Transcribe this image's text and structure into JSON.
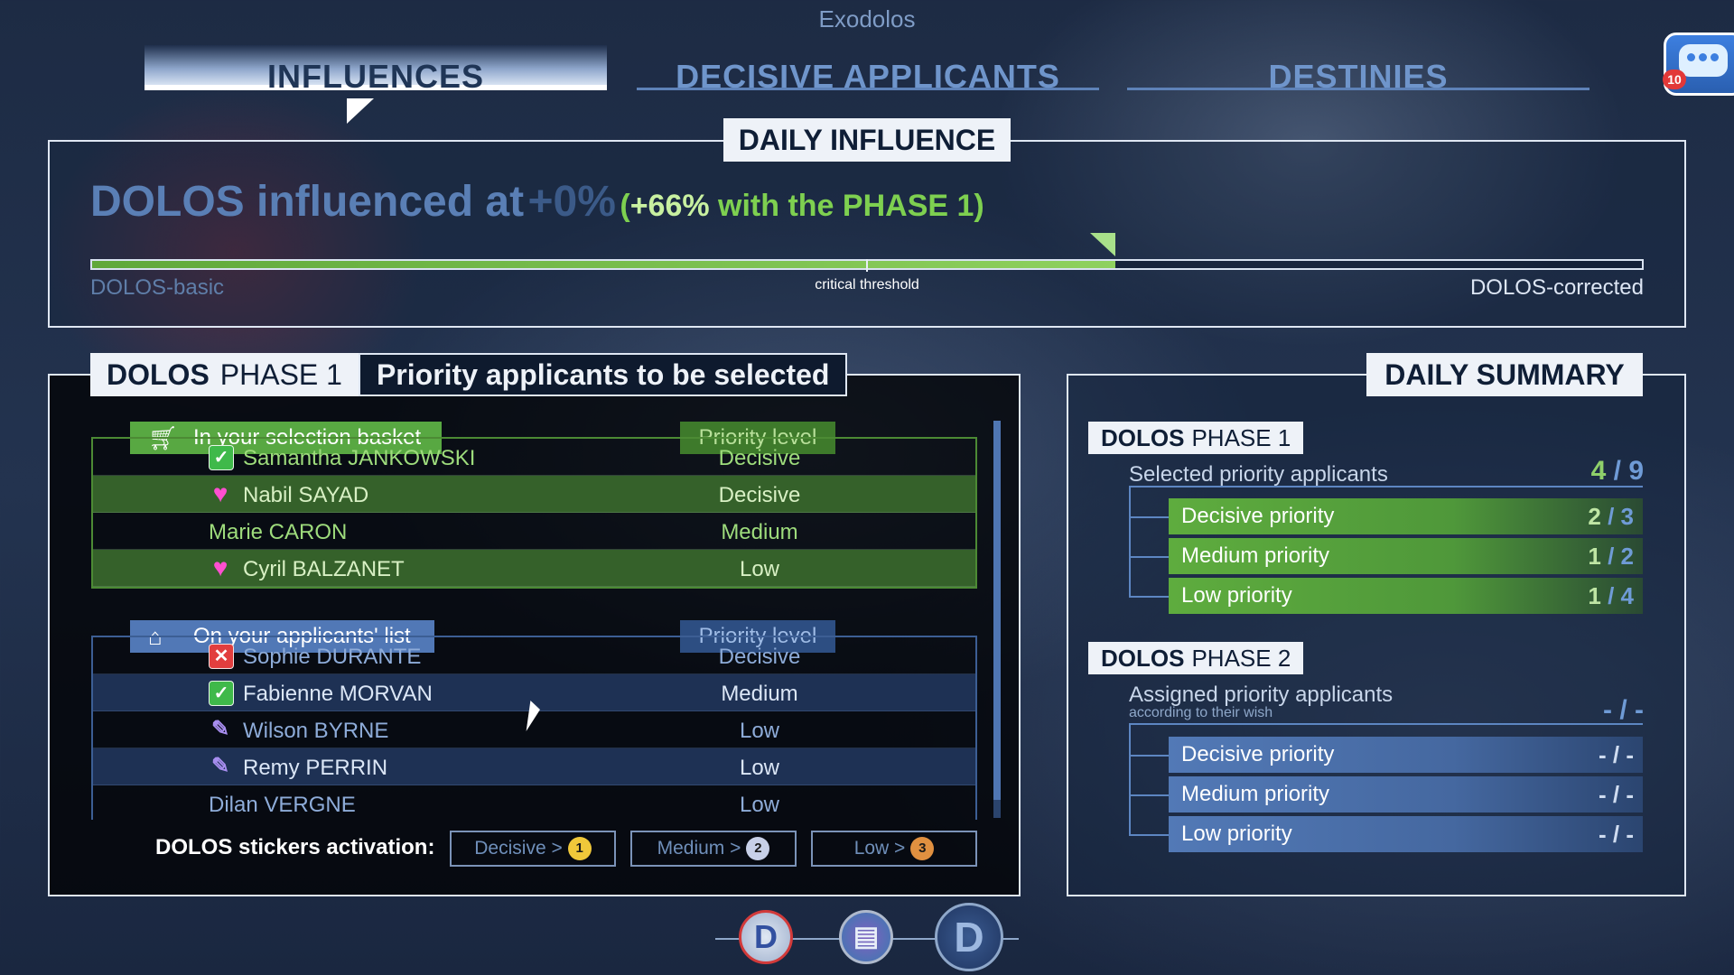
{
  "app": {
    "title": "Exodolos"
  },
  "tabs": [
    {
      "label": "INFLUENCES",
      "active": true
    },
    {
      "label": "DECISIVE APPLICANTS",
      "active": false
    },
    {
      "label": "DESTINIES",
      "active": false
    }
  ],
  "chat": {
    "icon": "chat-bubble-icon",
    "count": "10"
  },
  "daily_influence": {
    "title": "DAILY INFLUENCE",
    "headline": "DOLOS influenced at",
    "value": "+0%",
    "phase_note_prefix": "(",
    "phase_note_value": "+66%",
    "phase_note_suffix": " with the PHASE 1)",
    "bar": {
      "progress_fraction": 0.66,
      "critical_threshold_fraction": 0.5
    },
    "label_left": "DOLOS-basic",
    "label_center": "critical threshold",
    "label_right": "DOLOS-corrected"
  },
  "phase1_panel": {
    "phase_brand": "DOLOS",
    "phase_name": "PHASE 1",
    "subtitle": "Priority applicants to be selected",
    "basket": {
      "header": "In your selection basket",
      "icon": "cart-icon",
      "priority_header": "Priority level",
      "rows": [
        {
          "name": "Samantha JANKOWSKI",
          "priority": "Decisive",
          "icon": "check-icon"
        },
        {
          "name": "Nabil SAYAD",
          "priority": "Decisive",
          "icon": "heart-icon"
        },
        {
          "name": "Marie CARON",
          "priority": "Medium",
          "icon": ""
        },
        {
          "name": "Cyril BALZANET",
          "priority": "Low",
          "icon": "heart-icon"
        }
      ]
    },
    "applicants": {
      "header": "On your applicants' list",
      "icon": "graduation-cap-icon",
      "priority_header": "Priority level",
      "rows": [
        {
          "name": "Sophie DURANTE",
          "priority": "Decisive",
          "icon": "x-icon"
        },
        {
          "name": "Fabienne MORVAN",
          "priority": "Medium",
          "icon": "check-icon"
        },
        {
          "name": "Wilson BYRNE",
          "priority": "Low",
          "icon": "pin-icon"
        },
        {
          "name": "Remy PERRIN",
          "priority": "Low",
          "icon": "pin-icon"
        },
        {
          "name": "Dilan VERGNE",
          "priority": "Low",
          "icon": ""
        }
      ]
    },
    "stickers": {
      "label": "DOLOS stickers activation:",
      "buttons": [
        {
          "label": "Decisive >",
          "num": "1",
          "color": "#f0c83a"
        },
        {
          "label": "Medium >",
          "num": "2",
          "color": "#c8d0e8"
        },
        {
          "label": "Low >",
          "num": "3",
          "color": "#e09040"
        }
      ]
    }
  },
  "daily_summary": {
    "title": "DAILY SUMMARY",
    "phase1": {
      "brand": "DOLOS",
      "name": "PHASE 1",
      "line_label": "Selected priority applicants",
      "total_done": "4",
      "total_sep": " / ",
      "total_max": "9",
      "rows": [
        {
          "label": "Decisive priority",
          "done": "2",
          "sep": " / ",
          "max": "3"
        },
        {
          "label": "Medium priority",
          "done": "1",
          "sep": " / ",
          "max": "2"
        },
        {
          "label": "Low priority",
          "done": "1",
          "sep": " / ",
          "max": "4"
        }
      ]
    },
    "phase2": {
      "brand": "DOLOS",
      "name": "PHASE 2",
      "line_label": "Assigned priority applicants",
      "line_sub": "according to their wish",
      "total": "- / -",
      "rows": [
        {
          "label": "Decisive priority",
          "value": "- / -"
        },
        {
          "label": "Medium priority",
          "value": "- / -"
        },
        {
          "label": "Low priority",
          "value": "- / -"
        }
      ]
    }
  },
  "bottom_nav": [
    {
      "icon": "dolos-d-red-icon",
      "glyph": "D"
    },
    {
      "icon": "newspaper-icon",
      "glyph": "▤"
    },
    {
      "icon": "dolos-d-blue-icon",
      "glyph": "D"
    }
  ]
}
